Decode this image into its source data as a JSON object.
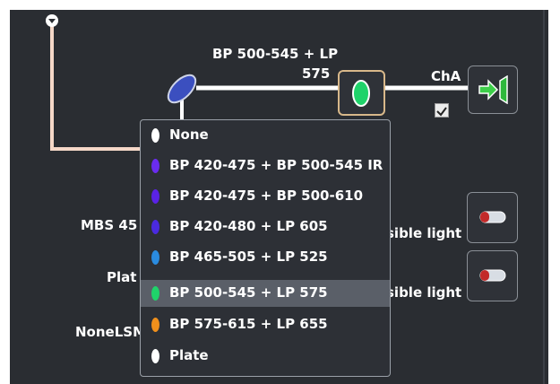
{
  "beam_path": {
    "filter_label_line1": "BP 500-545 + LP",
    "filter_label_line2": "575",
    "channel_label": "ChA",
    "channel_checked": true
  },
  "left_labels": {
    "mbs": "MBS 45",
    "plate": "Plat",
    "none_lsm": "NoneLSM"
  },
  "right_labels": {
    "visible_light_1": "sible light",
    "visible_light_2": "sible light"
  },
  "dropdown": {
    "items": [
      {
        "label": "None",
        "color": "#ffffff",
        "selected": false
      },
      {
        "label": "BP 420-475 + BP 500-545 IR",
        "color": "#6a2cf0",
        "selected": false
      },
      {
        "label": "BP 420-475 + BP 500-610",
        "color": "#5a22e6",
        "selected": false
      },
      {
        "label": "BP 420-480 + LP 605",
        "color": "#4a2ae0",
        "selected": false
      },
      {
        "label": "BP 465-505 + LP 525",
        "color": "#2a8be0",
        "selected": false
      },
      {
        "label": "BP 500-545 + LP 575",
        "color": "#1fd36a",
        "selected": true
      },
      {
        "label": "BP 575-615 + LP 655",
        "color": "#f0901c",
        "selected": false
      },
      {
        "label": "Plate",
        "color": "#ffffff",
        "selected": false
      }
    ]
  },
  "colors": {
    "panel_bg": "#2a2d32",
    "beam_white": "#ffffff",
    "beam_peach": "#f5d8c8",
    "selected_filter": "#1fd36a",
    "exit_arrow": "#3ecf4a"
  },
  "icons": [
    "collapse-icon",
    "mirror-icon",
    "filter-icon",
    "detector-exit-icon",
    "checkbox-icon",
    "lamp-icon"
  ]
}
